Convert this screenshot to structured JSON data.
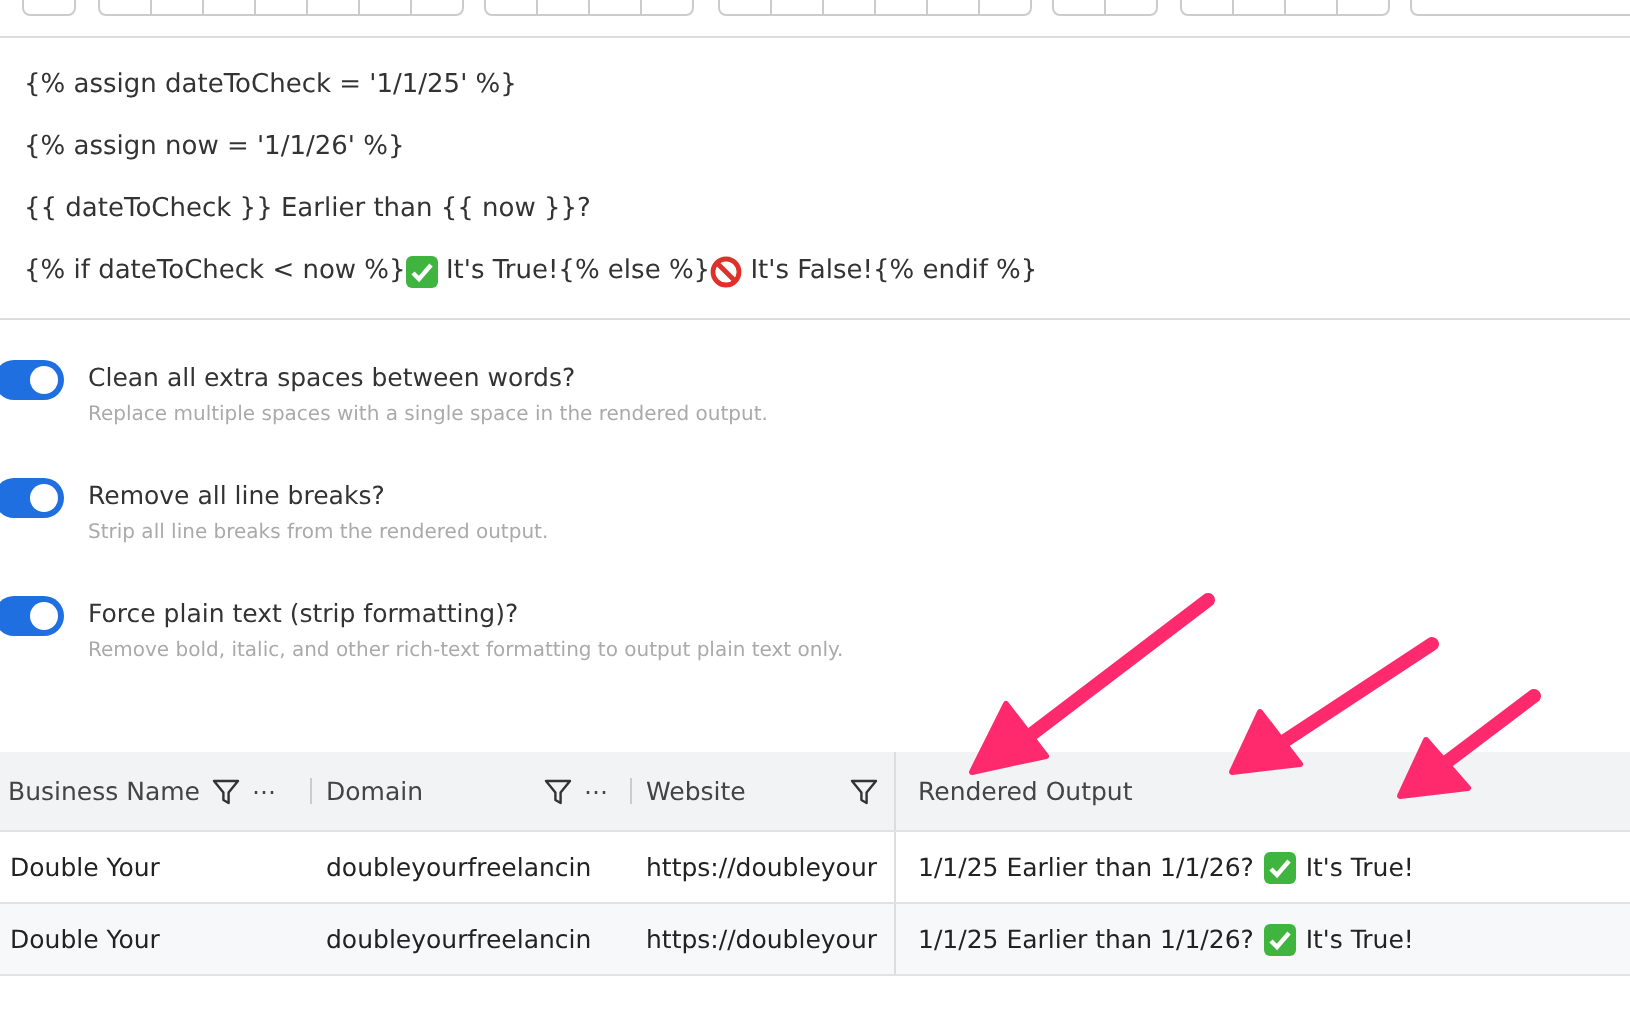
{
  "editor": {
    "lines": [
      [
        {
          "kind": "text",
          "text": "{% assign dateToCheck = '1/1/25' %}"
        }
      ],
      [
        {
          "kind": "text",
          "text": "{% assign now = '1/1/26' %}"
        }
      ],
      [
        {
          "kind": "text",
          "text": "{{ dateToCheck }} Earlier than {{ now }}?"
        }
      ],
      [
        {
          "kind": "text",
          "text": "{% if dateToCheck < now %}"
        },
        {
          "kind": "check"
        },
        {
          "kind": "text",
          "text": " It's True!{% else %}"
        },
        {
          "kind": "prohibited"
        },
        {
          "kind": "text",
          "text": " It's False!{% endif %}"
        }
      ]
    ]
  },
  "options": [
    {
      "label": "Clean all extra spaces between words?",
      "hint": "Replace multiple spaces with a single space in the rendered output.",
      "on": true
    },
    {
      "label": "Remove all line breaks?",
      "hint": "Strip all line breaks from the rendered output.",
      "on": true
    },
    {
      "label": "Force plain text (strip formatting)?",
      "hint": "Remove bold, italic, and other rich-text formatting to output plain text only.",
      "on": true
    }
  ],
  "table": {
    "columns": [
      {
        "label": "Business Name",
        "filter": true,
        "menu": "⋯"
      },
      {
        "label": "Domain",
        "filter": true,
        "menu": "⋯"
      },
      {
        "label": "Website",
        "filter": true
      },
      {
        "label": "Rendered Output",
        "filter": false
      }
    ],
    "rows": [
      [
        [
          {
            "kind": "text",
            "text": "Double Your"
          }
        ],
        [
          {
            "kind": "text",
            "text": "doubleyourfreelancin"
          }
        ],
        [
          {
            "kind": "text",
            "text": "https://doubleyour"
          }
        ],
        [
          {
            "kind": "text",
            "text": "1/1/25 Earlier than 1/1/26? "
          },
          {
            "kind": "check"
          },
          {
            "kind": "text",
            "text": " It's True!"
          }
        ]
      ],
      [
        [
          {
            "kind": "text",
            "text": "Double Your"
          }
        ],
        [
          {
            "kind": "text",
            "text": "doubleyourfreelancin"
          }
        ],
        [
          {
            "kind": "text",
            "text": "https://doubleyour"
          }
        ],
        [
          {
            "kind": "text",
            "text": "1/1/25 Earlier than 1/1/26? "
          },
          {
            "kind": "check"
          },
          {
            "kind": "text",
            "text": " It's True!"
          }
        ]
      ]
    ]
  }
}
